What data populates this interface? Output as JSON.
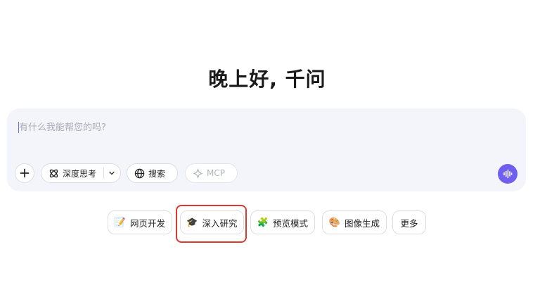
{
  "greeting": "晚上好, 千问",
  "composer": {
    "placeholder": "有什么我能帮您的吗?",
    "value": ""
  },
  "toolbar": {
    "add_icon": "plus-icon",
    "deep_think_label": "深度思考",
    "deep_think_icon": "atom-icon",
    "search_label": "搜索",
    "search_icon": "globe-icon",
    "mcp_label": "MCP",
    "mcp_icon": "sparkle-icon",
    "voice_icon": "voice-wave-icon",
    "voice_color": "#6f5ff0"
  },
  "quick_actions": [
    {
      "label": "网页开发",
      "icon": "memo-icon",
      "glyph": "📝"
    },
    {
      "label": "深入研究",
      "icon": "graduation-cap-icon",
      "glyph": "🎓"
    },
    {
      "label": "预览模式",
      "icon": "puzzle-icon",
      "glyph": "🧩"
    },
    {
      "label": "图像生成",
      "icon": "palette-icon",
      "glyph": "🎨"
    },
    {
      "label": "更多"
    }
  ],
  "highlight_color": "#d83a2e"
}
